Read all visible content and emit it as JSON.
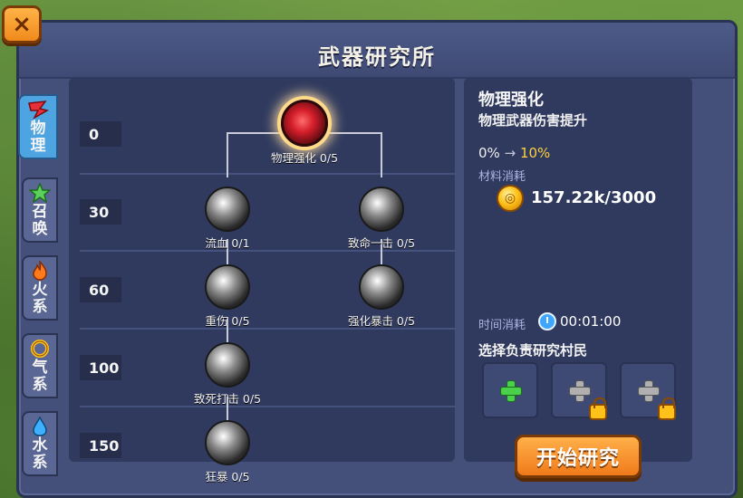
{
  "window": {
    "title": "武器研究所",
    "close_label": "×"
  },
  "tabs": [
    {
      "label_line1": "物",
      "label_line2": "理",
      "icon": "red-wing-icon",
      "active": true
    },
    {
      "label_line1": "召",
      "label_line2": "唤",
      "icon": "green-star-icon",
      "active": false
    },
    {
      "label_line1": "火",
      "label_line2": "系",
      "icon": "fire-icon",
      "active": false
    },
    {
      "label_line1": "气",
      "label_line2": "系",
      "icon": "wind-ring-icon",
      "active": false
    },
    {
      "label_line1": "水",
      "label_line2": "系",
      "icon": "water-drop-icon",
      "active": false
    }
  ],
  "tiers": [
    "0",
    "30",
    "60",
    "100",
    "150"
  ],
  "nodes": {
    "n0": {
      "name": "物理强化 0/5",
      "icon": "red-orb-icon",
      "selected": true
    },
    "n1a": {
      "name": "流血 0/1",
      "icon": "blood-drop-icon"
    },
    "n1b": {
      "name": "致命一击 0/5",
      "icon": "critical-strike-icon"
    },
    "n2a": {
      "name": "重伤 0/5",
      "icon": "vortex-icon"
    },
    "n2b": {
      "name": "强化暴击 0/5",
      "icon": "crossed-claws-icon"
    },
    "n3a": {
      "name": "致死打击 0/5",
      "icon": "fatal-blow-icon"
    },
    "n4a": {
      "name": "狂暴 0/5",
      "icon": "berserk-icon"
    }
  },
  "detail": {
    "title": "物理强化",
    "description": "物理武器伤害提升",
    "stat_current": "0%",
    "stat_arrow": "→",
    "stat_next": "10%",
    "cost_label": "材料消耗",
    "cost_value": "157.22k/3000",
    "time_label": "时间消耗",
    "time_value": "00:01:00",
    "select_label": "选择负责研究村民",
    "slots": [
      {
        "type": "add",
        "locked": false
      },
      {
        "type": "add",
        "locked": true
      },
      {
        "type": "add",
        "locked": true
      }
    ],
    "start_button": "开始研究"
  },
  "colors": {
    "accent_orange": "#f08a1c",
    "gold_text": "#ffd23f",
    "panel": "#44507a"
  }
}
